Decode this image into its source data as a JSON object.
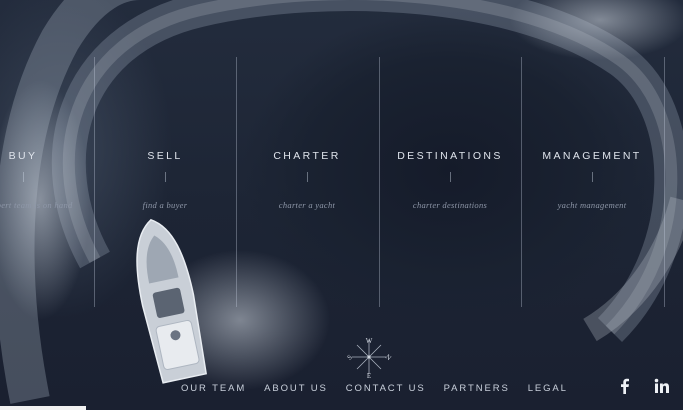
{
  "nav": {
    "columns": [
      {
        "title": "BUY",
        "subtitle": "our expert team is on hand"
      },
      {
        "title": "SELL",
        "subtitle": "find a buyer"
      },
      {
        "title": "CHARTER",
        "subtitle": "charter a yacht"
      },
      {
        "title": "DESTINATIONS",
        "subtitle": "charter destinations"
      },
      {
        "title": "MANAGEMENT",
        "subtitle": "yacht management"
      }
    ]
  },
  "compass": {
    "letters": [
      "W",
      "N",
      "E",
      "S"
    ],
    "icon": "compass-rose-icon"
  },
  "footer": {
    "links": [
      "OUR TEAM",
      "ABOUT US",
      "CONTACT US",
      "PARTNERS",
      "LEGAL"
    ]
  },
  "social": {
    "facebook": "f",
    "linkedin": "in"
  },
  "colors": {
    "background": "#1d2535",
    "text": "#dfe4ec",
    "subtext": "#8e97a8"
  }
}
